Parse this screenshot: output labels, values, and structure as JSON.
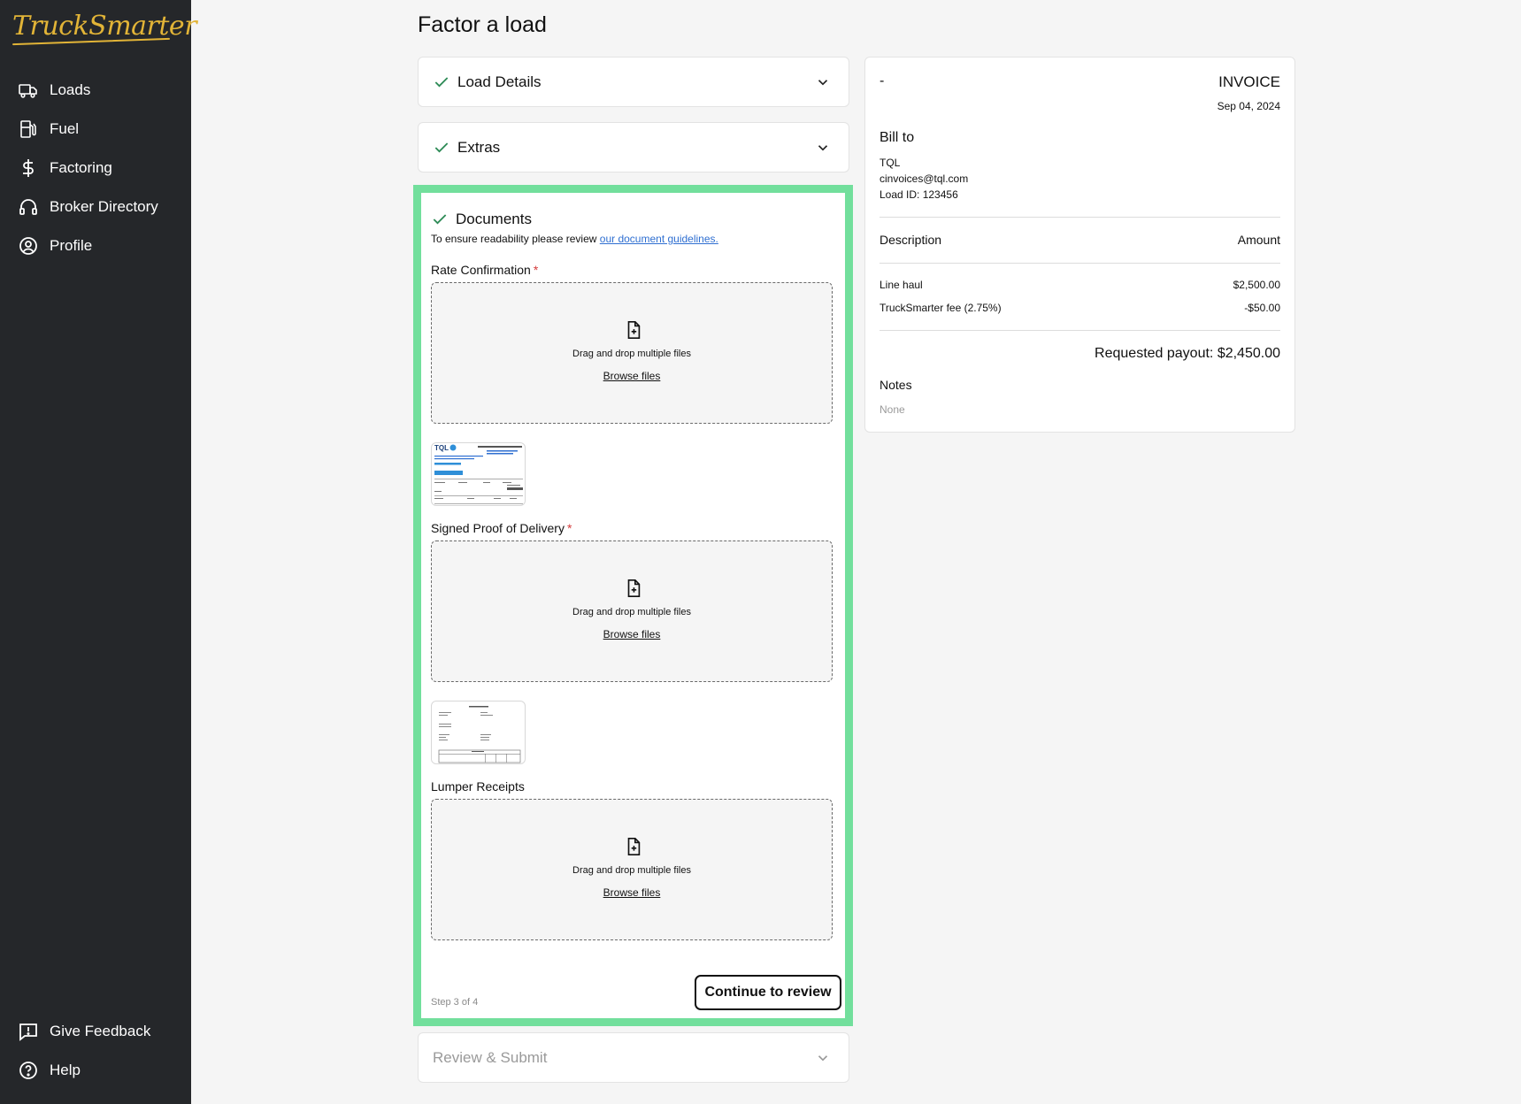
{
  "brand": {
    "logo_text": "TruckSmarter",
    "accent": "#e2b437",
    "highlight": "#72df9c"
  },
  "sidebar": {
    "items": [
      {
        "label": "Loads",
        "icon": "truck-icon"
      },
      {
        "label": "Fuel",
        "icon": "fuel-pump-icon"
      },
      {
        "label": "Factoring",
        "icon": "dollar-icon"
      },
      {
        "label": "Broker Directory",
        "icon": "headset-icon"
      },
      {
        "label": "Profile",
        "icon": "user-circle-icon"
      }
    ],
    "bottom": [
      {
        "label": "Give Feedback",
        "icon": "feedback-icon"
      },
      {
        "label": "Help",
        "icon": "help-circle-icon"
      }
    ]
  },
  "page": {
    "title": "Factor a load"
  },
  "sections": {
    "load_details": {
      "label": "Load Details"
    },
    "extras": {
      "label": "Extras"
    },
    "documents": {
      "label": "Documents",
      "note_prefix": "To ensure readability please review ",
      "note_link": "our document guidelines.",
      "fields": [
        {
          "label": "Rate Confirmation",
          "required": "*",
          "drop_text": "Drag and drop multiple files",
          "browse": "Browse files"
        },
        {
          "label": "Signed Proof of Delivery",
          "required": "*",
          "drop_text": "Drag and drop multiple files",
          "browse": "Browse files"
        },
        {
          "label": "Lumper Receipts",
          "required": "",
          "drop_text": "Drag and drop multiple files",
          "browse": "Browse files"
        }
      ],
      "step_text": "Step 3 of 4",
      "continue_label": "Continue to review"
    },
    "review": {
      "label": "Review & Submit"
    }
  },
  "invoice": {
    "dash": "-",
    "title": "INVOICE",
    "date": "Sep 04, 2024",
    "bill_to_label": "Bill to",
    "bill_to_name": "TQL",
    "bill_to_email": "cinvoices@tql.com",
    "load_id": "Load ID: 123456",
    "col_description": "Description",
    "col_amount": "Amount",
    "lines": [
      {
        "description": "Line haul",
        "amount": "$2,500.00"
      },
      {
        "description": "TruckSmarter fee (2.75%)",
        "amount": "-$50.00"
      }
    ],
    "payout": "Requested payout: $2,450.00",
    "notes_label": "Notes",
    "notes_value": "None"
  }
}
